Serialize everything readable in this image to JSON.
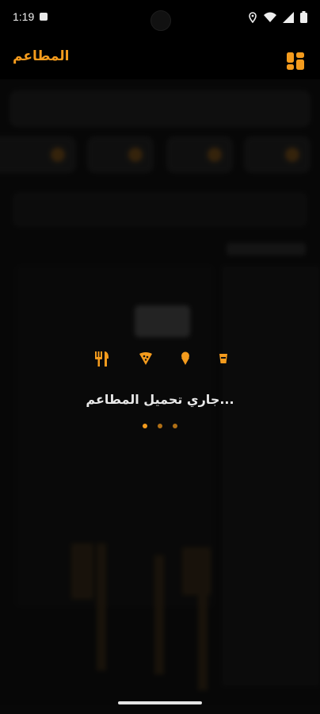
{
  "status_bar": {
    "time": "1:19",
    "icons": [
      "notification-icon",
      "location-icon",
      "wifi-icon",
      "signal-icon",
      "battery-icon"
    ]
  },
  "app_bar": {
    "title": "المطاعم",
    "menu_icon": "grid-menu-icon"
  },
  "loading": {
    "icons": [
      "fork-knife-icon",
      "pizza-icon",
      "ice-cream-icon",
      "cup-icon"
    ],
    "text": "...جاري تحميل المطاعم"
  },
  "colors": {
    "accent": "#f49b1d",
    "background": "#0e0e0e",
    "bar": "#000000"
  }
}
